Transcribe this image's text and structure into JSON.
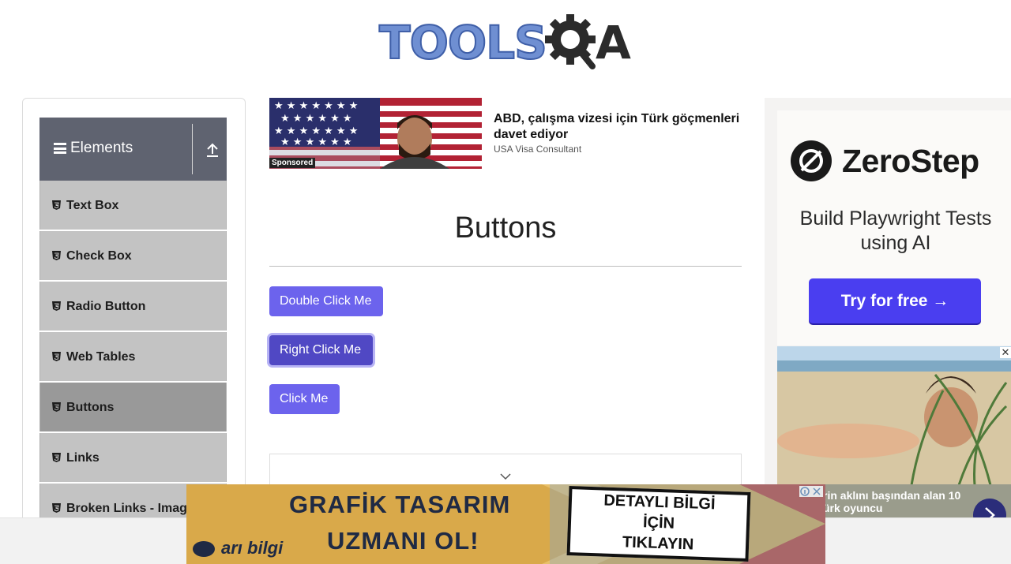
{
  "logo": {
    "text": "TOOLS",
    "suffix": "A"
  },
  "sidebar": {
    "group_title": "Elements",
    "items": [
      {
        "label": "Text Box"
      },
      {
        "label": "Check Box"
      },
      {
        "label": "Radio Button"
      },
      {
        "label": "Web Tables"
      },
      {
        "label": "Buttons",
        "active": true
      },
      {
        "label": "Links"
      },
      {
        "label": "Broken Links - Images"
      }
    ]
  },
  "top_ad": {
    "sponsored": "Sponsored",
    "title": "ABD, çalışma vizesi için Türk göçmenleri davet ediyor",
    "source": "USA Visa Consultant"
  },
  "main": {
    "title": "Buttons",
    "buttons": {
      "double_click": "Double Click Me",
      "right_click": "Right Click Me",
      "click": "Click Me"
    }
  },
  "right_ad": {
    "brand": "ZeroStep",
    "tagline": "Build Playwright Tests using AI",
    "cta": "Try for free →"
  },
  "beach_ad": {
    "caption_line1": "rin aklını başından alan 10",
    "caption_line2": "ürk oyuncu",
    "close": "✕"
  },
  "banner": {
    "line1": "GRAFİK TASARIM",
    "line2": "UZMANI OL!",
    "brand": "arı bilgi",
    "cta_l1": "DETAYLI BİLGİ",
    "cta_l2": "İÇİN",
    "cta_l3": "TIKLAYIN"
  },
  "colors": {
    "primary_button": "#6c63ed",
    "sidebar_header": "#5f6370",
    "sidebar_item": "#c3c3c3",
    "sidebar_item_active": "#999999"
  }
}
